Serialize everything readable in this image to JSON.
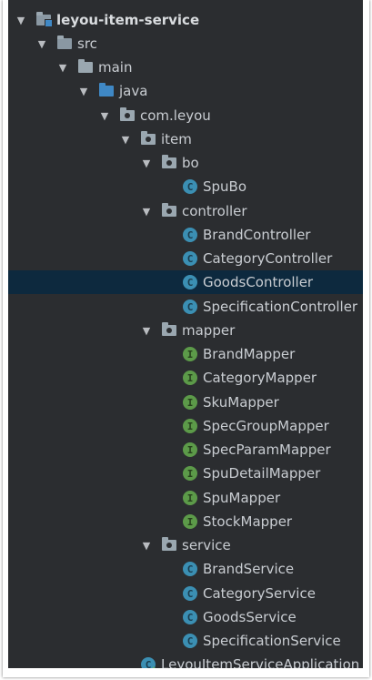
{
  "project_tree": {
    "root": {
      "label": "leyou-item-service"
    },
    "src": {
      "label": "src"
    },
    "main": {
      "label": "main"
    },
    "java": {
      "label": "java"
    },
    "com_leyou": {
      "label": "com.leyou"
    },
    "item": {
      "label": "item"
    },
    "bo": {
      "label": "bo",
      "children": [
        "SpuBo"
      ]
    },
    "controller": {
      "label": "controller",
      "children": [
        "BrandController",
        "CategoryController",
        "GoodsController",
        "SpecificationController"
      ]
    },
    "mapper": {
      "label": "mapper",
      "children": [
        "BrandMapper",
        "CategoryMapper",
        "SkuMapper",
        "SpecGroupMapper",
        "SpecParamMapper",
        "SpuDetailMapper",
        "SpuMapper",
        "StockMapper"
      ]
    },
    "service": {
      "label": "service",
      "children": [
        "BrandService",
        "CategoryService",
        "GoodsService",
        "SpecificationService"
      ]
    },
    "application": {
      "label": "LeyouItemServiceApplication"
    },
    "selected": "GoodsController"
  },
  "icons": {
    "expanded": "triangle-down-icon",
    "module_folder": "module-folder-icon",
    "source_root": "source-root-folder-icon",
    "package": "package-folder-icon",
    "class": "class-c-icon",
    "interface": "interface-i-icon",
    "spring_app": "spring-boot-app-icon"
  },
  "colors": {
    "background": "#2b2d30",
    "selection": "#0d293e",
    "text": "#c9cdd2",
    "class_badge": "#3b8fb3",
    "interface_badge": "#5c9a49",
    "java_folder": "#3f88c5"
  }
}
